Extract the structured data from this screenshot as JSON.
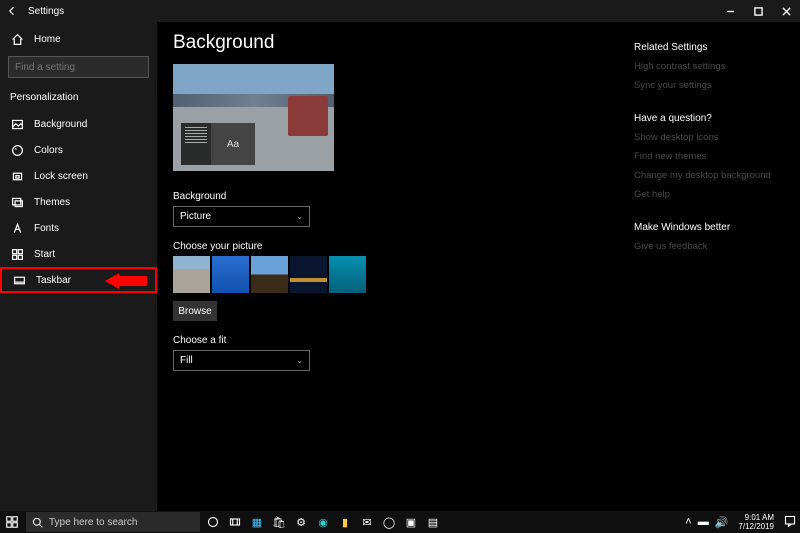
{
  "titlebar": {
    "title": "Settings"
  },
  "sidebar": {
    "home": "Home",
    "search_placeholder": "Find a setting",
    "category": "Personalization",
    "items": [
      {
        "label": "Background"
      },
      {
        "label": "Colors"
      },
      {
        "label": "Lock screen"
      },
      {
        "label": "Themes"
      },
      {
        "label": "Fonts"
      },
      {
        "label": "Start"
      },
      {
        "label": "Taskbar"
      }
    ]
  },
  "main": {
    "heading": "Background",
    "preview_sample": "Aa",
    "bg_label": "Background",
    "bg_value": "Picture",
    "choose_label": "Choose your picture",
    "browse": "Browse",
    "fit_label": "Choose a fit",
    "fit_value": "Fill"
  },
  "right": {
    "related_head": "Related Settings",
    "related": [
      "High contrast settings",
      "Sync your settings"
    ],
    "question_head": "Have a question?",
    "question": [
      "Show desktop icons",
      "Find new themes",
      "Change my desktop background",
      "Get help"
    ],
    "better_head": "Make Windows better",
    "better": [
      "Give us feedback"
    ]
  },
  "taskbar": {
    "search_placeholder": "Type here to search",
    "time": "9:01 AM",
    "date": "7/12/2019"
  }
}
